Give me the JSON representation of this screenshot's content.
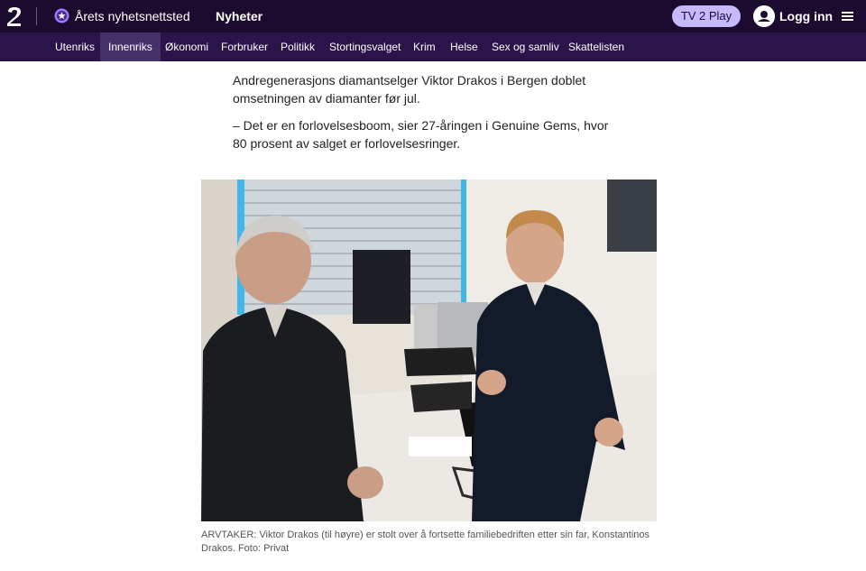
{
  "header": {
    "logo": "tv2-logo",
    "award_label": "Årets nyhetsnettsted",
    "award_icon": "award-badge-icon",
    "section_title": "Nyheter",
    "play_button_label": "TV 2 Play",
    "login_label": "Logg inn",
    "user_icon": "user-icon",
    "menu_icon": "hamburger-menu-icon"
  },
  "nav": {
    "items": [
      {
        "label": "Utenriks"
      },
      {
        "label": "Innenriks",
        "active": true
      },
      {
        "label": "Økonomi"
      },
      {
        "label": "Forbruker"
      },
      {
        "label": "Politikk"
      },
      {
        "label": "Stortingsvalget"
      },
      {
        "label": "Krim"
      },
      {
        "label": "Helse"
      },
      {
        "label": "Sex og samliv"
      },
      {
        "label": "Skattelisten"
      }
    ]
  },
  "article": {
    "paragraphs": [
      "Andregenerasjons diamantselger Viktor Drakos i Bergen doblet omsetningen av diamanter før jul.",
      "– Det er en forlovelsesboom, sier 27-åringen i Genuine Gems, hvor 80 prosent av salget er forlovelsesringer."
    ]
  },
  "image": {
    "caption": "ARVTAKER: Viktor Drakos (til høyre) er stolt over å fortsette familiebedriften etter sin far, Konstantinos Drakos. Foto: Privat"
  },
  "colors": {
    "header_bg": "#1b0b2e",
    "nav_bg": "#2a1449",
    "nav_active_bg": "#46326a",
    "play_button_bg": "#c7b9ff"
  }
}
